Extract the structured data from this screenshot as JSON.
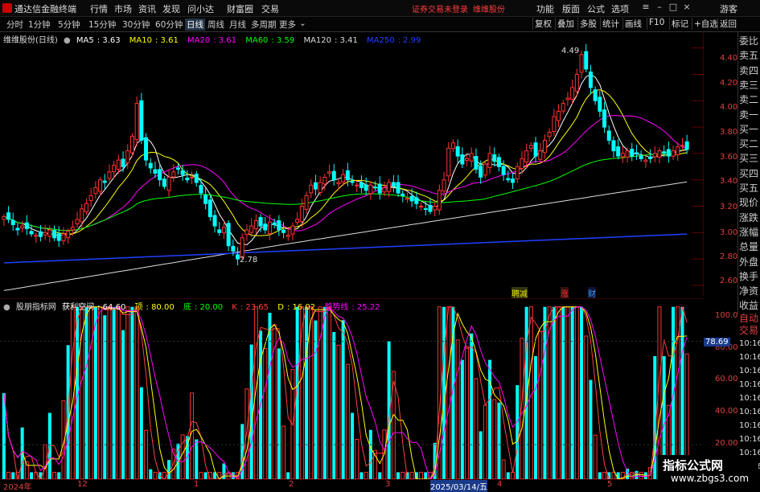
{
  "app": {
    "title": "通达信金融终端",
    "menu": [
      "行情",
      "市场",
      "资讯",
      "发现",
      "问小达",
      "财富圈",
      "交易"
    ],
    "notice": "证券交易未登录",
    "stock_link": "维维股份",
    "right_menu": [
      "功能",
      "版面",
      "公式",
      "选项"
    ],
    "user": "游客"
  },
  "toolbar": {
    "periods": [
      "分时",
      "1分钟",
      "5分钟",
      "15分钟",
      "30分钟",
      "60分钟",
      "日线",
      "周线",
      "月线",
      "多周期",
      "更多"
    ],
    "active_period": "日线",
    "buttons": [
      "复权",
      "叠加",
      "多股",
      "统计",
      "画线",
      "F10",
      "标记",
      "+自选",
      "返回"
    ]
  },
  "main_chart": {
    "stock_label": "维维股份(日线)",
    "ma": [
      {
        "name": "MA5",
        "value": "3.63",
        "color": "#ffffff"
      },
      {
        "name": "MA10",
        "value": "3.61",
        "color": "#ffff00"
      },
      {
        "name": "MA20",
        "value": "3.61",
        "color": "#ff00ff"
      },
      {
        "name": "MA60",
        "value": "3.59",
        "color": "#00ff00"
      },
      {
        "name": "MA120",
        "value": "3.41",
        "color": "#dddddd"
      },
      {
        "name": "MA250",
        "value": "2.99",
        "color": "#2040ff"
      }
    ],
    "y_ticks": [
      "4.40",
      "4.20",
      "4.00",
      "3.80",
      "3.60",
      "3.40",
      "3.20",
      "3.00",
      "2.80",
      "2.60"
    ],
    "high_label": "4.49",
    "low_label": "2.78",
    "events": [
      {
        "text": "聘减",
        "color": "#e0e000"
      },
      {
        "text": "涨",
        "color": "#ff3030"
      },
      {
        "text": "财",
        "color": "#30a0ff"
      }
    ]
  },
  "indicator": {
    "name": "股朋指标网",
    "params": [
      {
        "name": "获利空间",
        "value": "64.60",
        "color": "#ffffff"
      },
      {
        "name": "顶",
        "value": "80.00",
        "color": "#ffff00"
      },
      {
        "name": "底",
        "value": "20.00",
        "color": "#00ff00"
      },
      {
        "name": "K",
        "value": "23.65",
        "color": "#ff4040"
      },
      {
        "name": "D",
        "value": "16.02",
        "color": "#ffff00"
      },
      {
        "name": "趋势线",
        "value": "25.22",
        "color": "#ff00ff"
      }
    ],
    "y_ticks": [
      "100.0",
      "80.00",
      "60.00",
      "40.00",
      "20.00"
    ],
    "current_value": "78.69"
  },
  "side_panel": {
    "items": [
      "委比",
      "卖五",
      "卖四",
      "卖三",
      "卖二",
      "卖一",
      "买一",
      "买二",
      "买三",
      "买四",
      "买五",
      "现价",
      "涨跌",
      "涨幅",
      "总量",
      "外盘",
      "换手",
      "净资",
      "收益"
    ],
    "auto_trade": [
      "自动",
      "交易"
    ],
    "times": [
      "10:16",
      "10:16",
      "10:16",
      "10:16",
      "10:16",
      "10:16",
      "10:16",
      "10:16",
      "10:16",
      "10:16"
    ]
  },
  "date_axis": {
    "ticks": [
      "2024年",
      "12",
      "1",
      "2",
      "3",
      "2025/03/14/五",
      "4",
      "5"
    ]
  },
  "watermark": {
    "line1": "指标公式网",
    "line2": "www.zbgs3.com"
  },
  "chart_data": {
    "type": "candlestick",
    "closes": [
      3.12,
      3.1,
      3.06,
      3.02,
      3.05,
      3.03,
      2.99,
      2.98,
      2.97,
      3.0,
      3.02,
      2.96,
      2.94,
      2.99,
      3.01,
      3.04,
      3.1,
      3.18,
      3.22,
      3.28,
      3.34,
      3.4,
      3.38,
      3.46,
      3.51,
      3.55,
      3.5,
      3.62,
      3.73,
      3.98,
      3.7,
      3.55,
      3.49,
      3.45,
      3.4,
      3.35,
      3.42,
      3.46,
      3.48,
      3.44,
      3.4,
      3.42,
      3.38,
      3.3,
      3.22,
      3.12,
      3.05,
      3.0,
      3.04,
      2.9,
      2.86,
      2.8,
      2.96,
      3.02,
      3.05,
      3.09,
      3.05,
      3.02,
      3.08,
      3.06,
      3.02,
      3.0,
      2.98,
      3.05,
      3.1,
      3.2,
      3.28,
      3.36,
      3.33,
      3.38,
      3.42,
      3.46,
      3.4,
      3.38,
      3.44,
      3.4,
      3.38,
      3.36,
      3.34,
      3.32,
      3.36,
      3.34,
      3.3,
      3.34,
      3.38,
      3.35,
      3.3,
      3.28,
      3.26,
      3.24,
      3.22,
      3.2,
      3.18,
      3.16,
      3.2,
      3.32,
      3.4,
      3.64,
      3.68,
      3.58,
      3.52,
      3.56,
      3.6,
      3.48,
      3.42,
      3.52,
      3.6,
      3.54,
      3.5,
      3.44,
      3.4,
      3.38,
      3.5,
      3.56,
      3.62,
      3.66,
      3.58,
      3.62,
      3.7,
      3.76,
      3.88,
      3.92,
      3.98,
      4.02,
      4.1,
      4.2,
      4.35,
      4.24,
      4.1,
      4.0,
      3.92,
      3.8,
      3.7,
      3.62,
      3.58,
      3.6,
      3.62,
      3.58,
      3.6,
      3.56,
      3.55,
      3.56,
      3.6,
      3.62,
      3.6,
      3.58,
      3.62,
      3.65,
      3.66,
      3.63
    ]
  }
}
